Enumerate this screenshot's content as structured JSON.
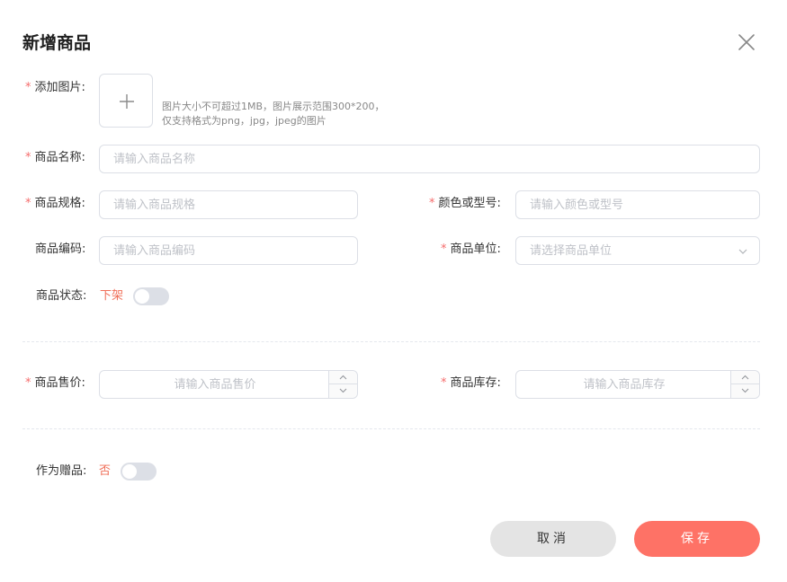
{
  "dialog": {
    "title": "新增商品"
  },
  "form": {
    "image": {
      "required_mark": "*",
      "label": "添加图片:",
      "hint_line1": "图片大小不可超过1MB，图片展示范围300*200，",
      "hint_line2": "仅支持格式为png，jpg，jpeg的图片"
    },
    "name": {
      "required_mark": "*",
      "label": "商品名称:",
      "value": "",
      "placeholder": "请输入商品名称"
    },
    "spec": {
      "required_mark": "*",
      "label": "商品规格:",
      "value": "",
      "placeholder": "请输入商品规格"
    },
    "color_model": {
      "required_mark": "*",
      "label": "颜色或型号:",
      "value": "",
      "placeholder": "请输入颜色或型号"
    },
    "code": {
      "label": "商品编码:",
      "value": "",
      "placeholder": "请输入商品编码"
    },
    "unit": {
      "required_mark": "*",
      "label": "商品单位:",
      "value": "",
      "placeholder": "请选择商品单位"
    },
    "status": {
      "label": "商品状态:",
      "value_text": "下架",
      "enabled": false
    },
    "price": {
      "required_mark": "*",
      "label": "商品售价:",
      "value": "",
      "placeholder": "请输入商品售价"
    },
    "stock": {
      "required_mark": "*",
      "label": "商品库存:",
      "value": "",
      "placeholder": "请输入商品库存"
    },
    "gift": {
      "label": "作为赠品:",
      "value_text": "否",
      "enabled": false
    }
  },
  "actions": {
    "cancel_label": "取消",
    "save_label": "保存"
  },
  "colors": {
    "required": "#f56c6c",
    "status_text": "#f0705a",
    "save_button": "#fe7266",
    "cancel_button": "#e4e4e4",
    "switch_off": "#dcdfe6"
  },
  "icons": {
    "close": "close-icon",
    "upload": "plus-icon",
    "select": "chevron-down-icon",
    "stepper_up": "chevron-up-icon",
    "stepper_down": "chevron-down-icon"
  }
}
